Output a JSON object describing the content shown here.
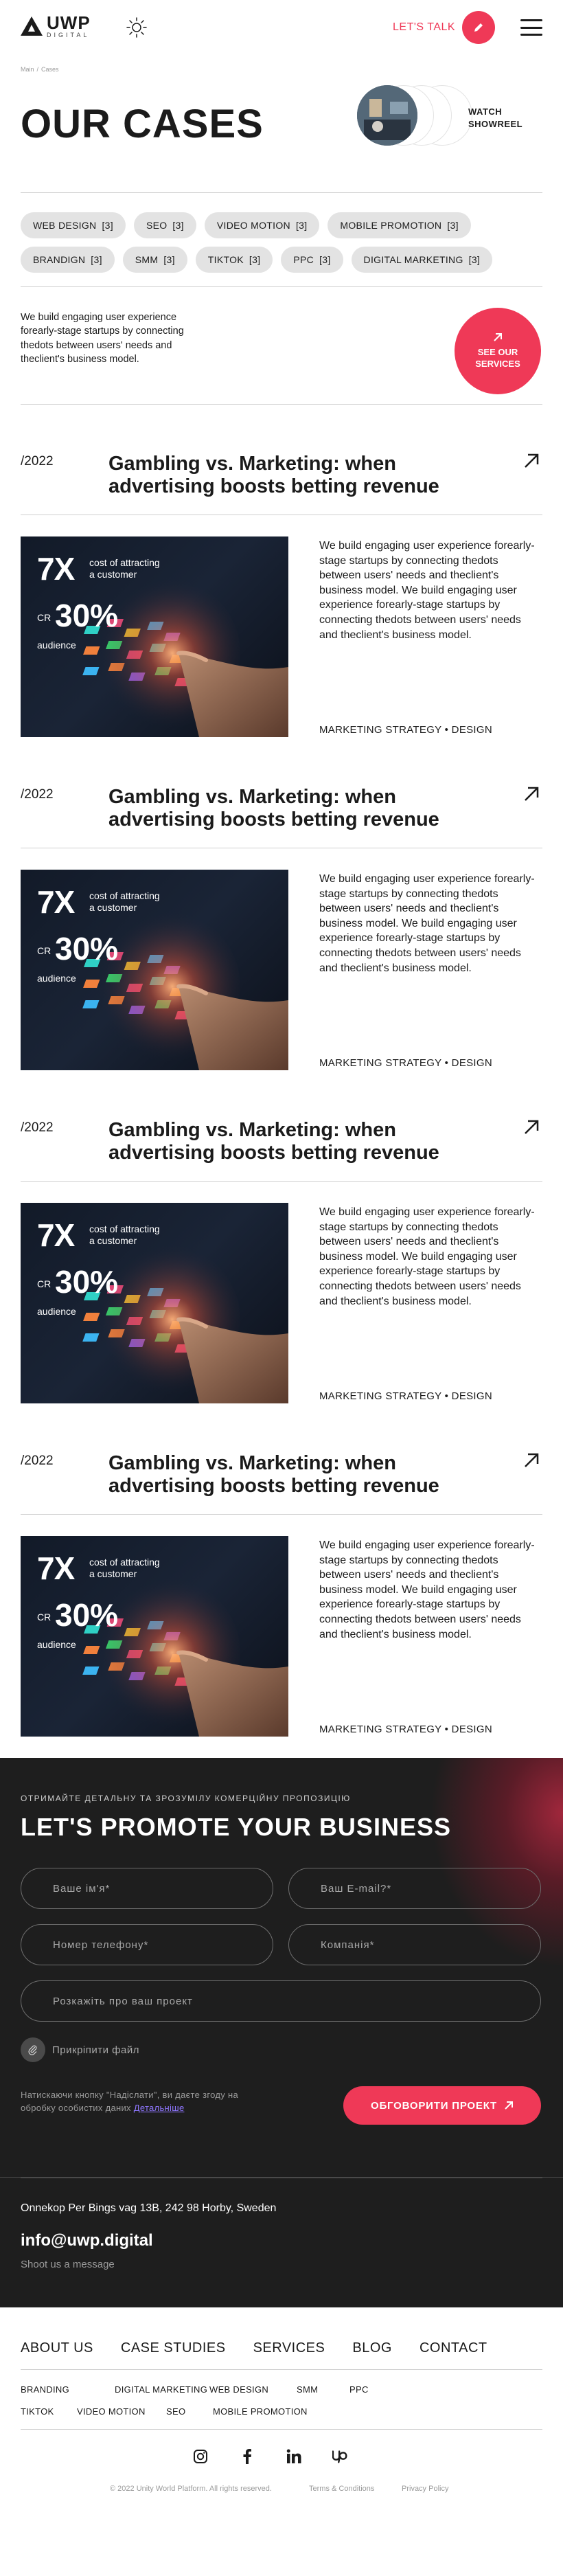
{
  "header": {
    "logo_word": "UWP",
    "logo_sub": "DIGITAL",
    "lets_talk": "LET'S TALK"
  },
  "breadcrumb": {
    "home": "Main",
    "separator": "/",
    "current": "Cases"
  },
  "hero": {
    "title": "OUR CASES",
    "showreel_line1": "WATCH",
    "showreel_line2": "SHOWREEL"
  },
  "tags": [
    {
      "label": "WEB DESIGN",
      "count": "[3]"
    },
    {
      "label": "SEO",
      "count": "[3]"
    },
    {
      "label": "VIDEO MOTION",
      "count": "[3]"
    },
    {
      "label": "MOBILE PROMOTION",
      "count": "[3]"
    },
    {
      "label": "BRANDIGN",
      "count": "[3]"
    },
    {
      "label": "SMM",
      "count": "[3]"
    },
    {
      "label": "TIKTOK",
      "count": "[3]"
    },
    {
      "label": "PPC",
      "count": "[3]"
    },
    {
      "label": "DIGITAL MARKETING",
      "count": "[3]"
    }
  ],
  "intro": {
    "text": "We build engaging user experience forearly-stage startups by connecting thedots between users' needs and theclient's business model.",
    "services_line1": "SEE OUR",
    "services_line2": "SERVICES"
  },
  "cases": [
    {
      "year": "/2022",
      "title": "Gambling vs. Marketing: when advertising boosts betting revenue",
      "stat1": "7X",
      "stat1_label": "cost of attracting a customer",
      "stat2_prefix": "CR",
      "stat2": "30%",
      "stat2_label": "audience",
      "description": "We build engaging user experience forearly-stage startups by connecting thedots between users' needs and theclient's business model. We build engaging user experience forearly-stage startups by connecting thedots between users' needs and theclient's business model.",
      "meta": "MARKETING STRATEGY • DESIGN"
    },
    {
      "year": "/2022",
      "title": "Gambling vs. Marketing: when advertising boosts betting revenue",
      "stat1": "7X",
      "stat1_label": "cost of attracting a customer",
      "stat2_prefix": "CR",
      "stat2": "30%",
      "stat2_label": "audience",
      "description": "We build engaging user experience forearly-stage startups by connecting thedots between users' needs and theclient's business model. We build engaging user experience forearly-stage startups by connecting thedots between users' needs and theclient's business model.",
      "meta": "MARKETING STRATEGY • DESIGN"
    },
    {
      "year": "/2022",
      "title": "Gambling vs. Marketing: when advertising boosts betting revenue",
      "stat1": "7X",
      "stat1_label": "cost of attracting a customer",
      "stat2_prefix": "CR",
      "stat2": "30%",
      "stat2_label": "audience",
      "description": "We build engaging user experience forearly-stage startups by connecting thedots between users' needs and theclient's business model. We build engaging user experience forearly-stage startups by connecting thedots between users' needs and theclient's business model.",
      "meta": "MARKETING STRATEGY • DESIGN"
    },
    {
      "year": "/2022",
      "title": "Gambling vs. Marketing: when advertising boosts betting revenue",
      "stat1": "7X",
      "stat1_label": "cost of attracting a customer",
      "stat2_prefix": "CR",
      "stat2": "30%",
      "stat2_label": "audience",
      "description": "We build engaging user experience forearly-stage startups by connecting thedots between users' needs and theclient's business model. We build engaging user experience forearly-stage startups by connecting thedots between users' needs and theclient's business model.",
      "meta": "MARKETING STRATEGY • DESIGN"
    }
  ],
  "promo": {
    "kicker": "ОТРИМАЙТЕ ДЕТАЛЬНУ ТА ЗРОЗУМІЛУ КОМЕРЦІЙНУ ПРОПОЗИЦІЮ",
    "title": "LET'S PROMOTE YOUR BUSINESS",
    "name_placeholder": "Ваше ім'я*",
    "email_placeholder": "Ваш E-mail?*",
    "phone_placeholder": "Номер телефону*",
    "company_placeholder": "Компанія*",
    "project_placeholder": "Розкажіть про ваш проект",
    "attach_label": "Прикріпити файл",
    "consent_text": "Натискаючи кнопку \"Надіслати\", ви даєте згоду на обробку особистих даних",
    "consent_link": "Детальніше",
    "submit_label": "ОБГОВОРИТИ ПРОЕКТ"
  },
  "contacts": {
    "address": "Onnekop Per Bings vag 13B, 242 98 Horby, Sweden",
    "email": "info@uwp.digital",
    "shoot": "Shoot us a message"
  },
  "footer": {
    "nav": [
      "ABOUT US",
      "CASE STUDIES",
      "SERVICES",
      "BLOG",
      "CONTACT"
    ],
    "sub_row1": [
      "BRANDING",
      "DIGITAL MARKETING",
      "WEB DESIGN",
      "SMM",
      "PPC"
    ],
    "sub_row2": [
      "TIKTOK",
      "VIDEO MOTION",
      "SEO",
      "MOBILE PROMOTION"
    ],
    "socials": [
      "instagram-icon",
      "facebook-icon",
      "linkedin-icon",
      "upwork-icon"
    ],
    "copyright": "© 2022 Unity World Platform. All rights reserved.",
    "terms": "Terms & Conditions",
    "privacy": "Privacy Policy"
  },
  "colors": {
    "accent": "#ef3957",
    "dark": "#1e1e1e",
    "tag_bg": "#e3e3e3"
  }
}
